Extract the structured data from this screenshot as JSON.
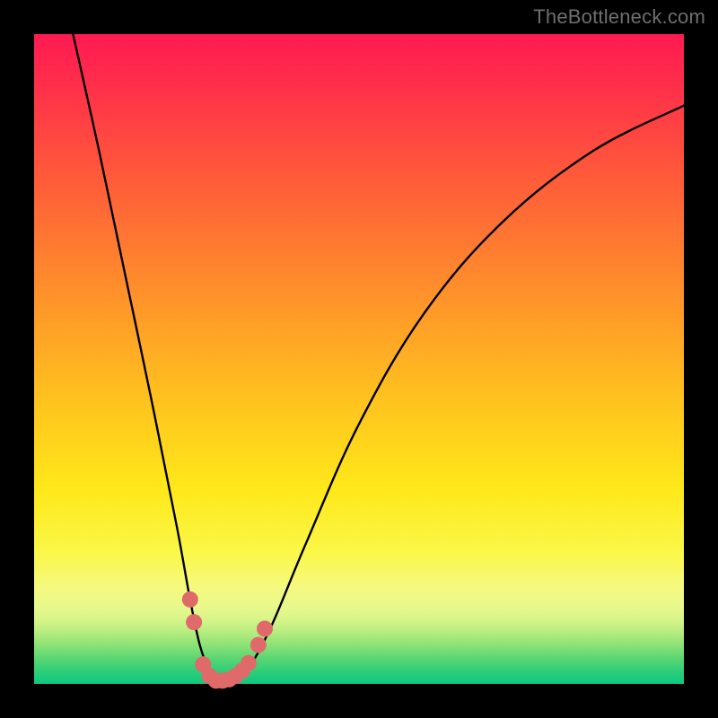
{
  "watermark": "TheBottleneck.com",
  "chart_data": {
    "type": "line",
    "title": "",
    "xlabel": "",
    "ylabel": "",
    "xlim": [
      0,
      100
    ],
    "ylim": [
      0,
      100
    ],
    "series": [
      {
        "name": "bottleneck-curve",
        "x": [
          6,
          10,
          14,
          18,
          22,
          24,
          25.5,
          27,
          28.5,
          30,
          32,
          34,
          37,
          42,
          50,
          60,
          72,
          86,
          100
        ],
        "values": [
          100,
          82,
          63,
          44,
          24,
          13,
          6,
          2,
          0.5,
          0.5,
          1.5,
          4,
          10,
          22,
          40,
          57,
          71,
          82,
          89
        ]
      }
    ],
    "markers": {
      "name": "highlight-dots",
      "color": "#e06a6a",
      "points": [
        {
          "x": 24.0,
          "y": 13.0
        },
        {
          "x": 24.6,
          "y": 9.5
        },
        {
          "x": 26.0,
          "y": 3.0
        },
        {
          "x": 27.0,
          "y": 1.2
        },
        {
          "x": 28.0,
          "y": 0.5
        },
        {
          "x": 29.0,
          "y": 0.5
        },
        {
          "x": 30.0,
          "y": 0.7
        },
        {
          "x": 31.0,
          "y": 1.2
        },
        {
          "x": 32.0,
          "y": 2.0
        },
        {
          "x": 33.0,
          "y": 3.2
        },
        {
          "x": 34.5,
          "y": 6.0
        },
        {
          "x": 35.5,
          "y": 8.5
        }
      ]
    }
  }
}
